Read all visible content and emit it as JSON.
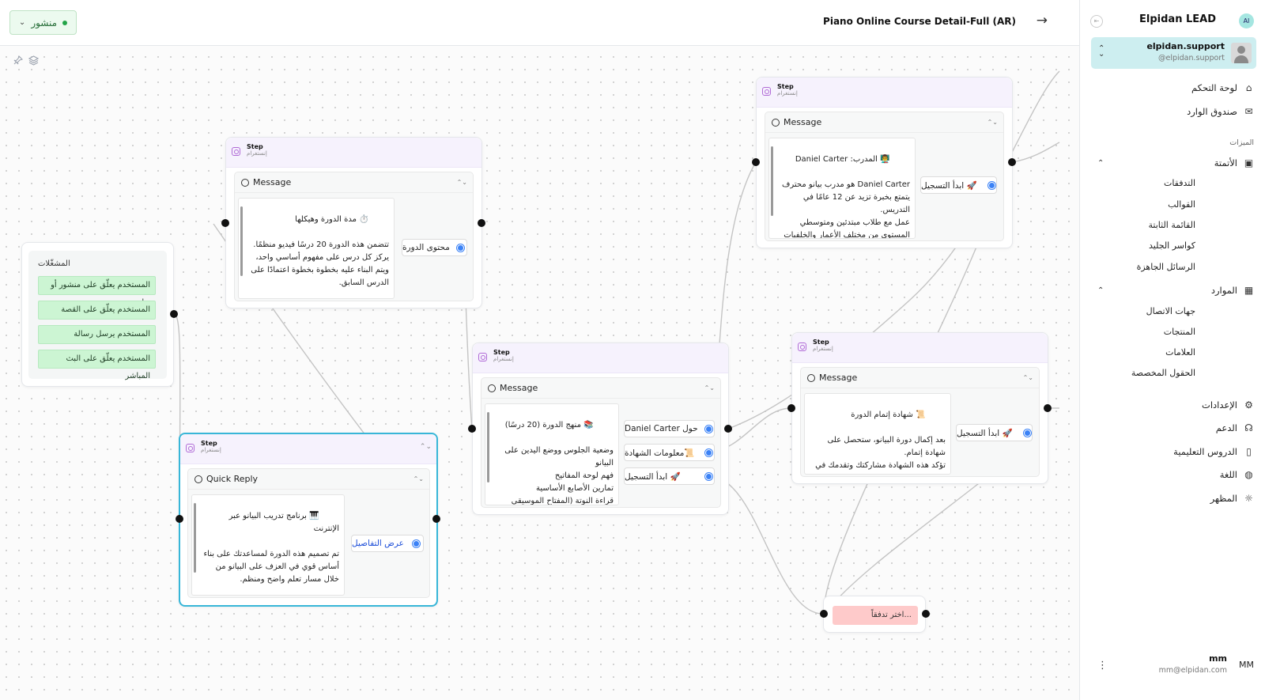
{
  "topbar": {
    "status_label": "منشور",
    "flow_title": "Piano Online Course Detail-Full (AR)"
  },
  "icons": {
    "back": "arrow-right-icon",
    "pin": "pin-icon",
    "layers": "layers-icon",
    "instagram": "instagram-icon"
  },
  "triggers": {
    "title": "المشغّلات",
    "items": [
      "المستخدم يعلّق على منشور أو ريل",
      "المستخدم يعلّق على القصة",
      "المستخدم يرسل رسالة",
      "المستخدم يعلّق على البث المباشر"
    ]
  },
  "nodes": {
    "duration": {
      "step": "Step",
      "platform": "إنستغرام",
      "card_type": "Message",
      "text": "⏱️ مدة الدورة وهيكلها\n\nتتضمن هذه الدورة 20 درسًا فيديو منظمًا.\nيركز كل درس على مفهوم أساسي واحد، ويتم البناء عليه بخطوة بخطوة اعتمادًا على الدرس السابق.\n\nالدروس قصيرة، مركزة، وسهلة المتابعة، بحيث",
      "buttons": [
        "محتوى الدورة"
      ]
    },
    "intro": {
      "step": "Step",
      "platform": "إنستغرام",
      "card_type": "Quick Reply",
      "text": "🎹 برنامج تدريب البيانو عبر الإنترنت\n\nتم تصميم هذه الدورة لمساعدتك على بناء أساس قوي في العزف على البيانو من خلال مسار تعلم واضح ومنظم.\n\n👇 اضغط على الزر أدناه لعرض تفاصيل الدورة الكاملة، هيكل الدروس، ومعلومات",
      "buttons": [
        "عرض التفاصيل"
      ]
    },
    "curriculum": {
      "step": "Step",
      "platform": "إنستغرام",
      "card_type": "Message",
      "text": "📚 منهج الدورة (20 درسًا)\n\nوضعية الجلوس ووضع اليدين على البيانو\nفهم لوحة المفاتيح\nتمارين الأصابع الأساسية\nقراءة النوتة (المفتاح الموسيقي العالي)",
      "buttons": [
        "حول Daniel Carter",
        "📜معلومات الشهادة",
        "🚀 ابدأ التسجيل"
      ]
    },
    "trainer": {
      "step": "Step",
      "platform": "إنستغرام",
      "card_type": "Message",
      "text": "👨‍🏫 المدرب: Daniel Carter\n\nDaniel Carter هو مدرب بيانو محترف يتمتع بخبرة تزيد عن 12 عامًا في التدريس.\nعمل مع طلاب مبتدئين ومتوسطي المستوى من مختلف الأعمار والخلفيات التعليمية.",
      "buttons": [
        "🚀 ابدأ التسجيل"
      ]
    },
    "certificate": {
      "step": "Step",
      "platform": "إنستغرام",
      "card_type": "Message",
      "text": "📜 شهادة إتمام الدورة\n\nبعد إكمال دورة البيانو، ستحصل على شهادة إتمام.\nتؤكد هذه الشهادة مشاركتك وتقدمك في التعلم ضمن البرنامج.",
      "buttons": [
        "🚀 ابدأ التسجيل"
      ]
    },
    "choose_flow": {
      "placeholder": "...اختر تدفقاً"
    }
  },
  "sidebar": {
    "brand": "Elpidan LEAD",
    "account": {
      "name": "elpidan.support",
      "handle": "@elpidan.support"
    },
    "dashboard": "لوحة التحكم",
    "inbox": "صندوق الوارد",
    "features_label": "الميزات",
    "automation": "الأتمتة",
    "automation_items": [
      "التدفقات",
      "القوالب",
      "القائمة الثابتة",
      "كواسر الجليد",
      "الرسائل الجاهزة"
    ],
    "resources": "الموارد",
    "resources_items": [
      "جهات الاتصال",
      "المنتجات",
      "العلامات",
      "الحقول المخصصة"
    ],
    "settings": "الإعدادات",
    "support": "الدعم",
    "tutorials": "الدروس التعليمية",
    "language": "اللغة",
    "appearance": "المظهر",
    "user": {
      "name": "mm",
      "email": "mm@elpidan.com",
      "initials": "MM"
    }
  },
  "colors": {
    "status_green": "#22a447",
    "step_header": "#f6f2fd",
    "trigger_bg": "#ccf5d3",
    "handle_blue": "#3b82f6",
    "choose_flow_bg": "#fecaca",
    "account_bg": "#cdeef0",
    "selected_border": "#38b6d8"
  }
}
